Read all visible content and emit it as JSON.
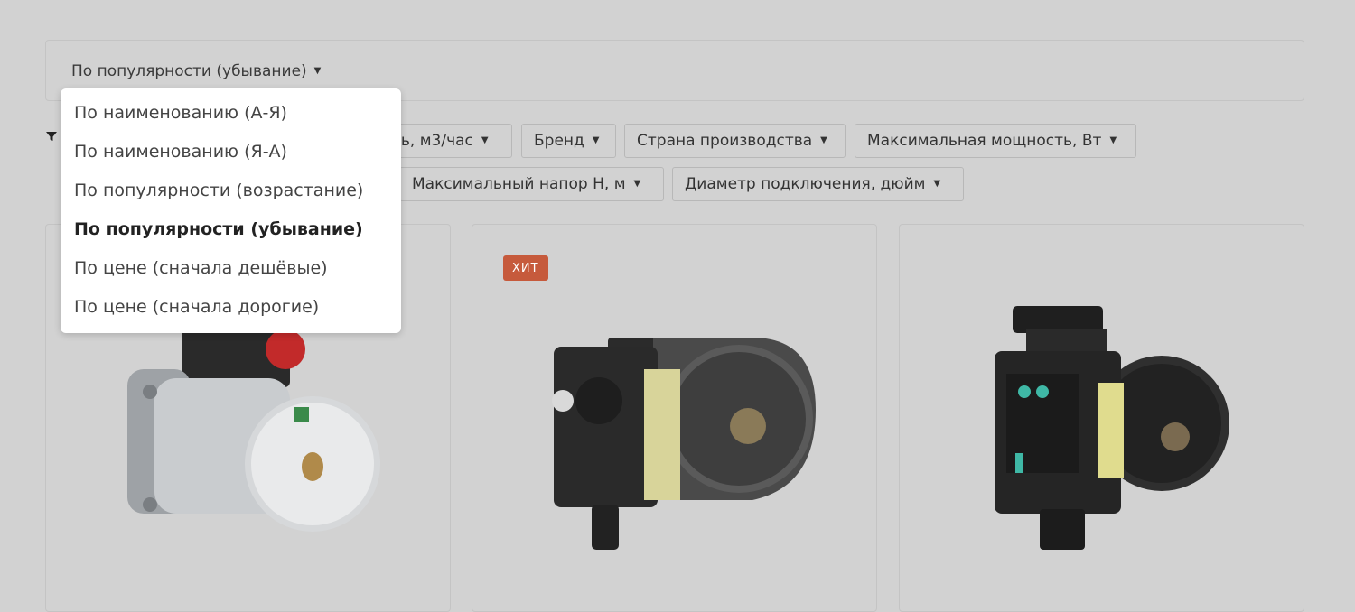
{
  "sort": {
    "current_label": "По популярности (убывание)",
    "options": [
      {
        "label": "По наименованию (А-Я)",
        "active": false
      },
      {
        "label": "По наименованию (Я-А)",
        "active": false
      },
      {
        "label": "По популярности (возрастание)",
        "active": false
      },
      {
        "label": "По популярности (убывание)",
        "active": true
      },
      {
        "label": "По цене (сначала дешёвые)",
        "active": false
      },
      {
        "label": "По цене (сначала дорогие)",
        "active": false
      }
    ]
  },
  "filters": [
    {
      "label": "ть, м3/час"
    },
    {
      "label": "Бренд"
    },
    {
      "label": "Страна производства"
    },
    {
      "label": "Максимальная мощность, Вт"
    },
    {
      "label": "Максимальный напор Н, м"
    },
    {
      "label": "Диаметр подключения, дюйм"
    }
  ],
  "products": [
    {
      "badge": ""
    },
    {
      "badge": "ХИТ"
    },
    {
      "badge": ""
    }
  ],
  "colors": {
    "background": "#d2d2d2",
    "badge": "#c65a3c",
    "dropdown_bg": "#ffffff"
  }
}
